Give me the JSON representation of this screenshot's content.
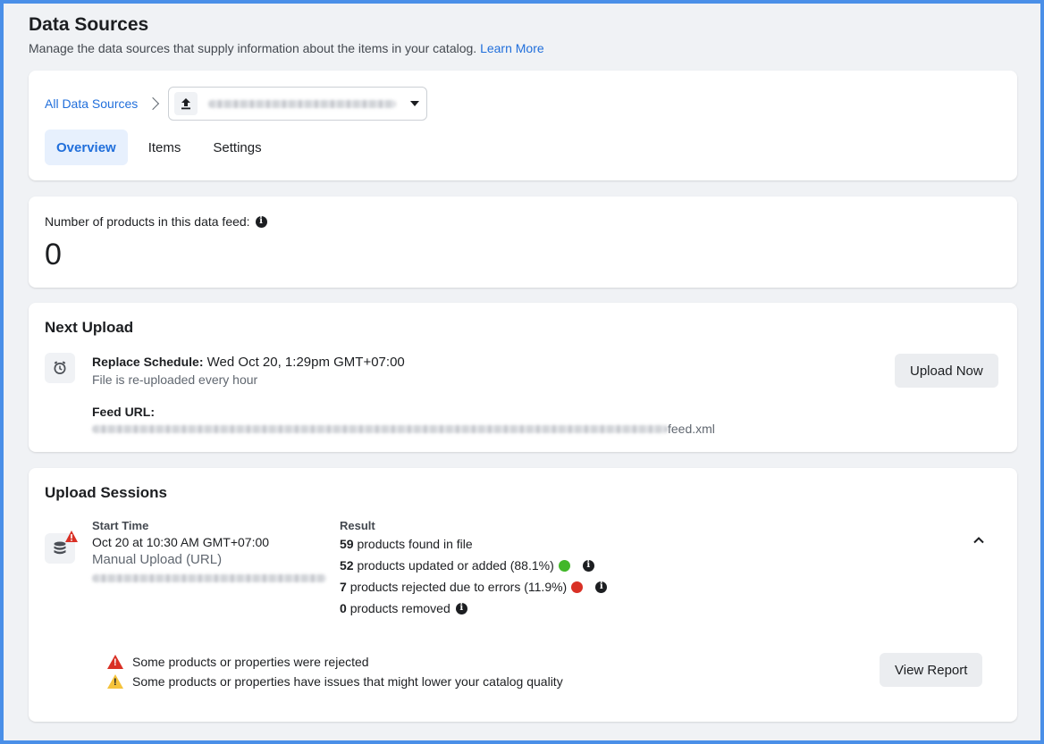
{
  "header": {
    "title": "Data Sources",
    "subtitle": "Manage the data sources that supply information about the items in your catalog.",
    "learn_more": "Learn More"
  },
  "breadcrumb": {
    "all_sources": "All Data Sources"
  },
  "tabs": [
    {
      "label": "Overview",
      "active": true
    },
    {
      "label": "Items",
      "active": false
    },
    {
      "label": "Settings",
      "active": false
    }
  ],
  "products_card": {
    "label": "Number of products in this data feed:",
    "count": "0"
  },
  "next_upload": {
    "title": "Next Upload",
    "schedule_label": "Replace Schedule:",
    "schedule_value": "Wed Oct 20, 1:29pm GMT+07:00",
    "frequency": "File is re-uploaded every hour",
    "feed_url_label": "Feed URL:",
    "feed_url_suffix": "feed.xml",
    "upload_button": "Upload Now"
  },
  "upload_sessions": {
    "title": "Upload Sessions",
    "start_time_label": "Start Time",
    "start_time_value": "Oct 20 at 10:30 AM GMT+07:00",
    "method": "Manual Upload (URL)",
    "result_label": "Result",
    "results": [
      {
        "count": "59",
        "text": "products found in file"
      },
      {
        "count": "52",
        "text": "products updated or added (88.1%)"
      },
      {
        "count": "7",
        "text": "products rejected due to errors (11.9%)"
      },
      {
        "count": "0",
        "text": "products removed"
      }
    ],
    "warnings": [
      "Some products or properties were rejected",
      "Some products or properties have issues that might lower your catalog quality"
    ],
    "view_report_button": "View Report"
  },
  "colors": {
    "accent": "#216fdb",
    "success": "#42b72a",
    "error": "#d93025",
    "warning": "#f5c33b"
  }
}
